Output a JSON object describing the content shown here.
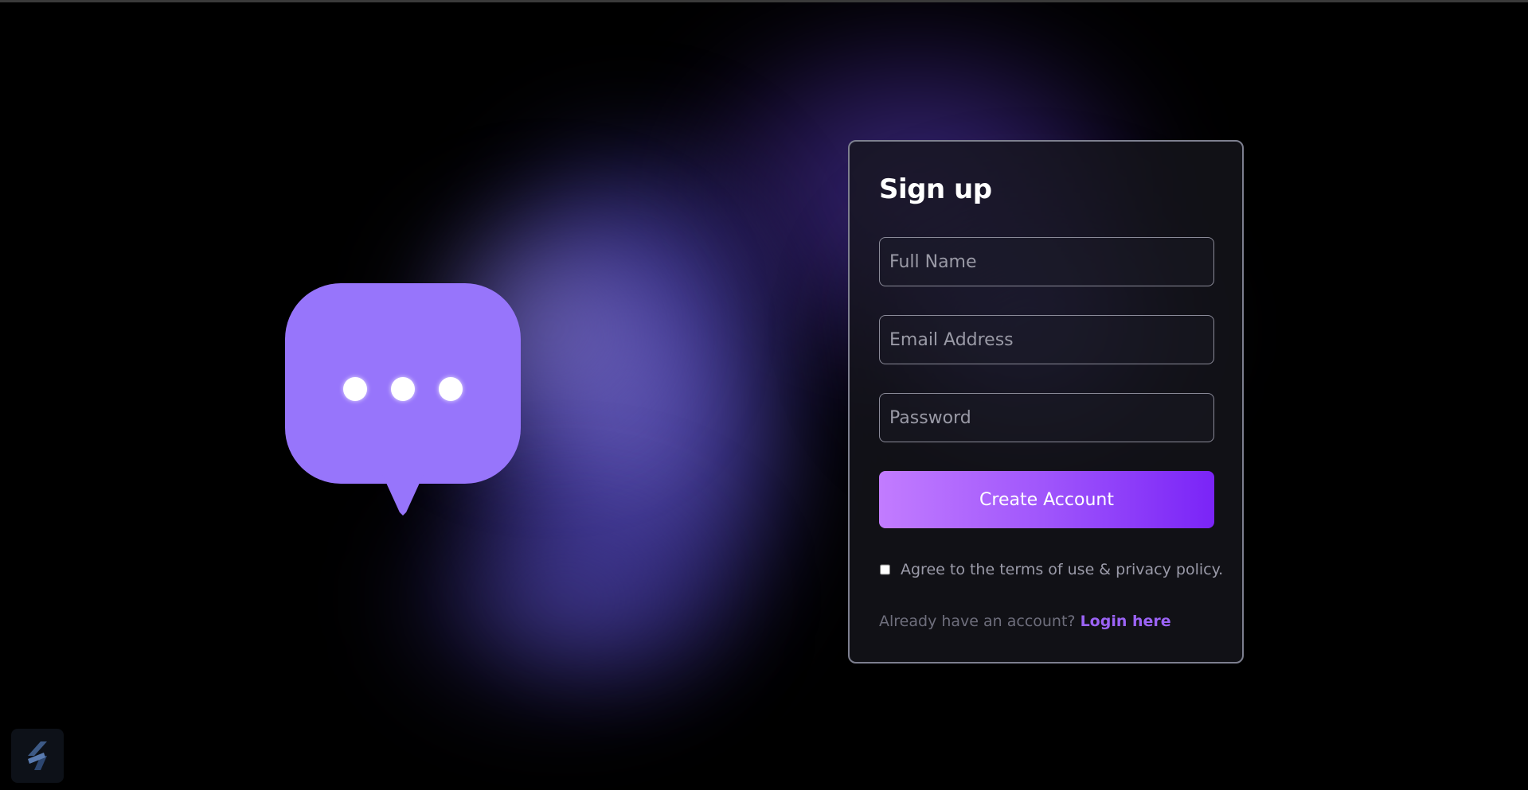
{
  "form": {
    "title": "Sign up",
    "full_name": {
      "placeholder": "Full Name",
      "value": ""
    },
    "email": {
      "placeholder": "Email Address",
      "value": ""
    },
    "password": {
      "placeholder": "Password",
      "value": ""
    },
    "submit_label": "Create Account",
    "agree": {
      "label": "Agree to the terms of use & privacy policy.",
      "checked": false
    },
    "login_prompt": "Already have an account?",
    "login_link": "Login here"
  },
  "illustration": {
    "icon": "chat-bubble-typing-icon",
    "color": "#9775fb"
  },
  "corner_logo": {
    "icon": "app-logo-icon"
  },
  "colors": {
    "background": "#000000",
    "accent_start": "#c27cff",
    "accent_end": "#7a24f7",
    "link": "#9b63f5",
    "card_border": "#7d7f8f"
  }
}
